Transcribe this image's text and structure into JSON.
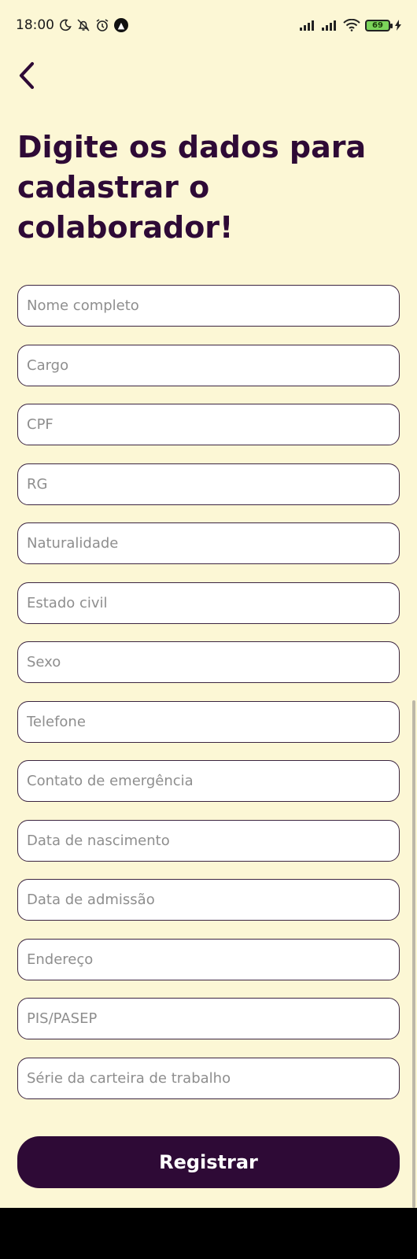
{
  "status_bar": {
    "time": "18:00",
    "battery_level": "69",
    "icons": [
      "moon-icon",
      "notifications-off-icon",
      "alarm-icon",
      "nav-app-icon",
      "signal-icon",
      "signal-icon",
      "wifi-icon",
      "battery-icon",
      "charging-icon"
    ]
  },
  "header": {
    "back_icon": "chevron-left-icon",
    "title": "Digite os dados para cadastrar o colaborador!"
  },
  "form": {
    "fields": [
      {
        "placeholder": "Nome completo",
        "value": ""
      },
      {
        "placeholder": "Cargo",
        "value": ""
      },
      {
        "placeholder": "CPF",
        "value": ""
      },
      {
        "placeholder": "RG",
        "value": ""
      },
      {
        "placeholder": "Naturalidade",
        "value": ""
      },
      {
        "placeholder": "Estado civil",
        "value": ""
      },
      {
        "placeholder": "Sexo",
        "value": ""
      },
      {
        "placeholder": "Telefone",
        "value": ""
      },
      {
        "placeholder": "Contato de emergência",
        "value": ""
      },
      {
        "placeholder": "Data de nascimento",
        "value": ""
      },
      {
        "placeholder": "Data de admissão",
        "value": ""
      },
      {
        "placeholder": "Endereço",
        "value": ""
      },
      {
        "placeholder": "PIS/PASEP",
        "value": ""
      },
      {
        "placeholder": "Série da carteira de trabalho",
        "value": ""
      }
    ],
    "submit_label": "Registrar"
  },
  "colors": {
    "background": "#FCF7D5",
    "accent": "#2E0A36",
    "field_border": "#3B2440",
    "placeholder": "#8E8E8E"
  }
}
